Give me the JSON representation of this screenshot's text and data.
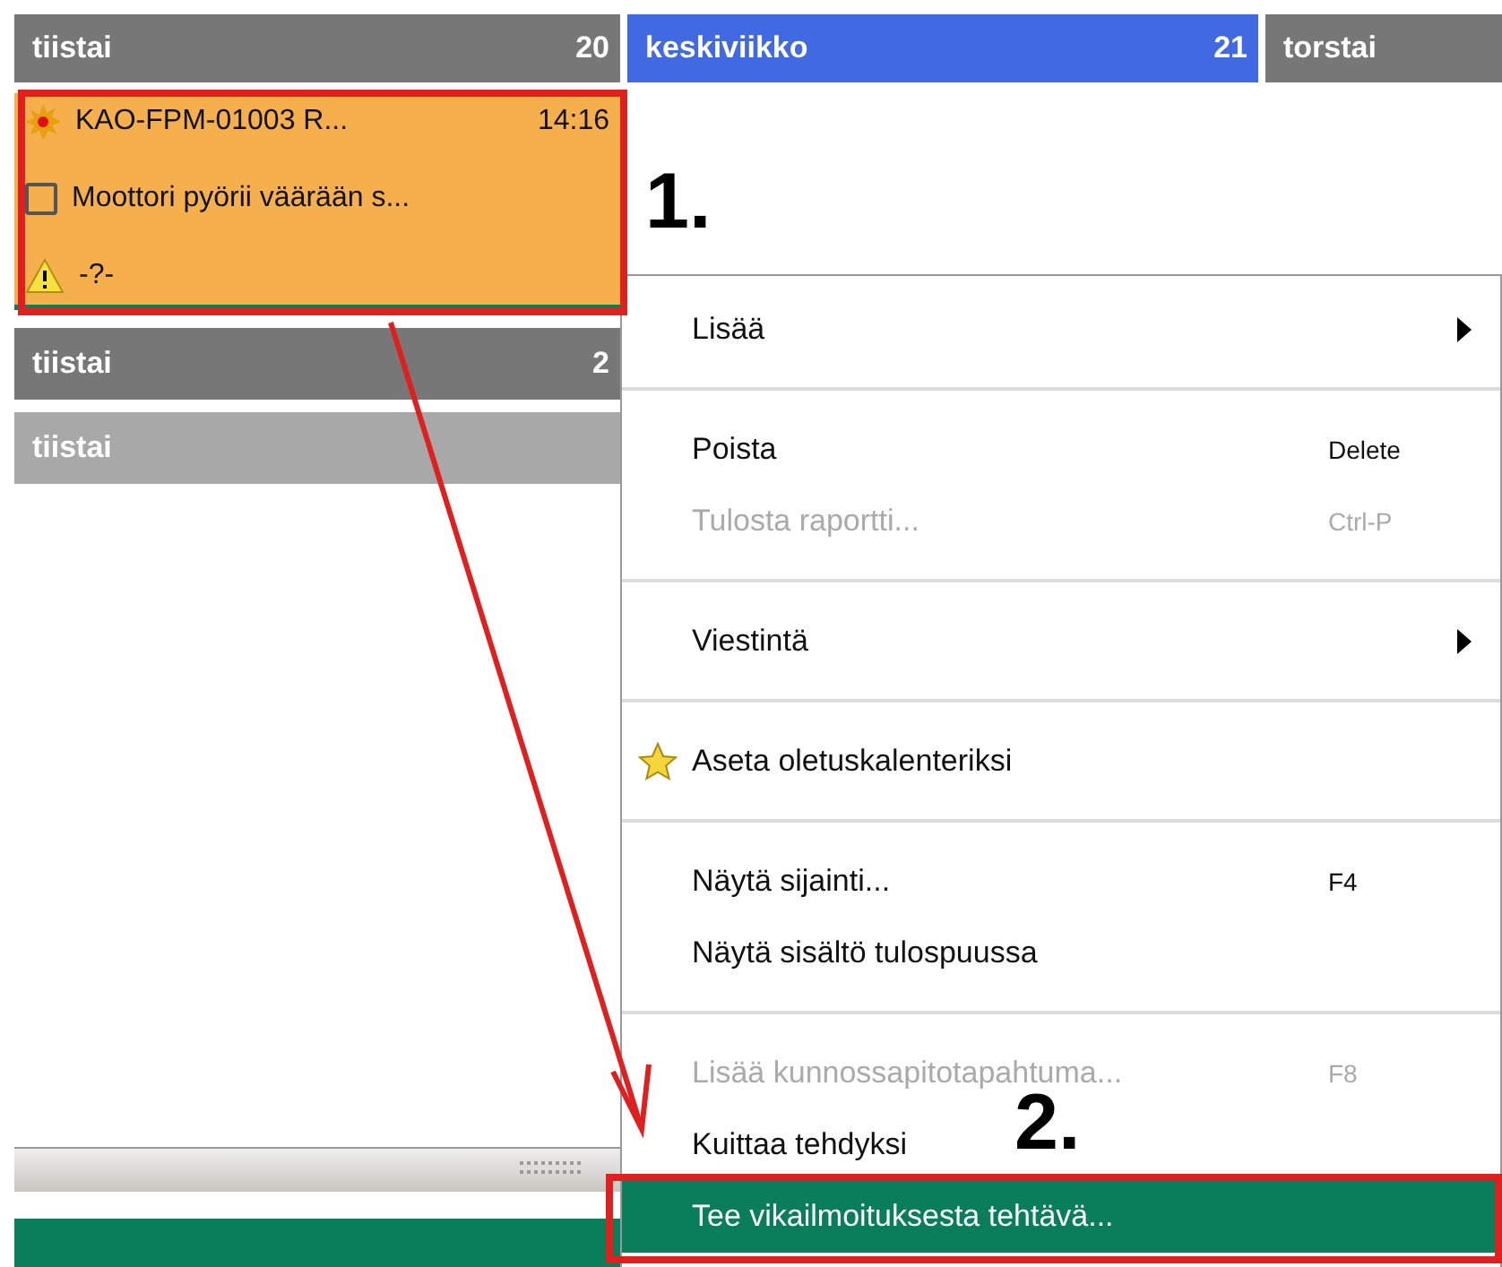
{
  "days": [
    {
      "name": "tiistai",
      "number": "20",
      "selected": false
    },
    {
      "name": "keskiviikko",
      "number": "21",
      "selected": true
    },
    {
      "name": "torstai",
      "selected": false
    }
  ],
  "event": {
    "title": "KAO-FPM-01003 R...",
    "time": "14:16",
    "description": "Moottori pyörii väärään s...",
    "checked": false,
    "status": "-?-"
  },
  "other_days": [
    {
      "name": "tiistai",
      "number": "2",
      "dimmed": false
    },
    {
      "name": "tiistai",
      "dimmed": true
    }
  ],
  "context_menu": [
    {
      "kind": "item",
      "label": "Lisää",
      "submenu": true,
      "disabled": false,
      "selected": false
    },
    {
      "kind": "separator"
    },
    {
      "kind": "item",
      "label": "Poista",
      "shortcut": "Delete",
      "disabled": false,
      "selected": false
    },
    {
      "kind": "item",
      "label": "Tulosta raportti...",
      "shortcut": "Ctrl-P",
      "disabled": true,
      "selected": false
    },
    {
      "kind": "separator"
    },
    {
      "kind": "item",
      "label": "Viestintä",
      "submenu": true,
      "disabled": false,
      "selected": false
    },
    {
      "kind": "separator"
    },
    {
      "kind": "item",
      "label": "Aseta oletuskalenteriksi",
      "icon": true,
      "disabled": false,
      "selected": false
    },
    {
      "kind": "separator"
    },
    {
      "kind": "item",
      "label": "Näytä sijainti...",
      "shortcut": "F4",
      "disabled": false,
      "selected": false
    },
    {
      "kind": "item",
      "label": "Näytä sisältö tulospuussa",
      "disabled": false,
      "selected": false
    },
    {
      "kind": "separator"
    },
    {
      "kind": "item",
      "label": "Lisää kunnossapitotapahtuma...",
      "shortcut": "F8",
      "disabled": true,
      "selected": false
    },
    {
      "kind": "item",
      "label": "Kuittaa tehdyksi",
      "disabled": false,
      "selected": false
    },
    {
      "kind": "item",
      "label": "Tee vikailmoituksesta tehtävä...",
      "disabled": false,
      "selected": true
    }
  ],
  "annotations": [
    {
      "label": "1."
    },
    {
      "label": "2."
    }
  ]
}
